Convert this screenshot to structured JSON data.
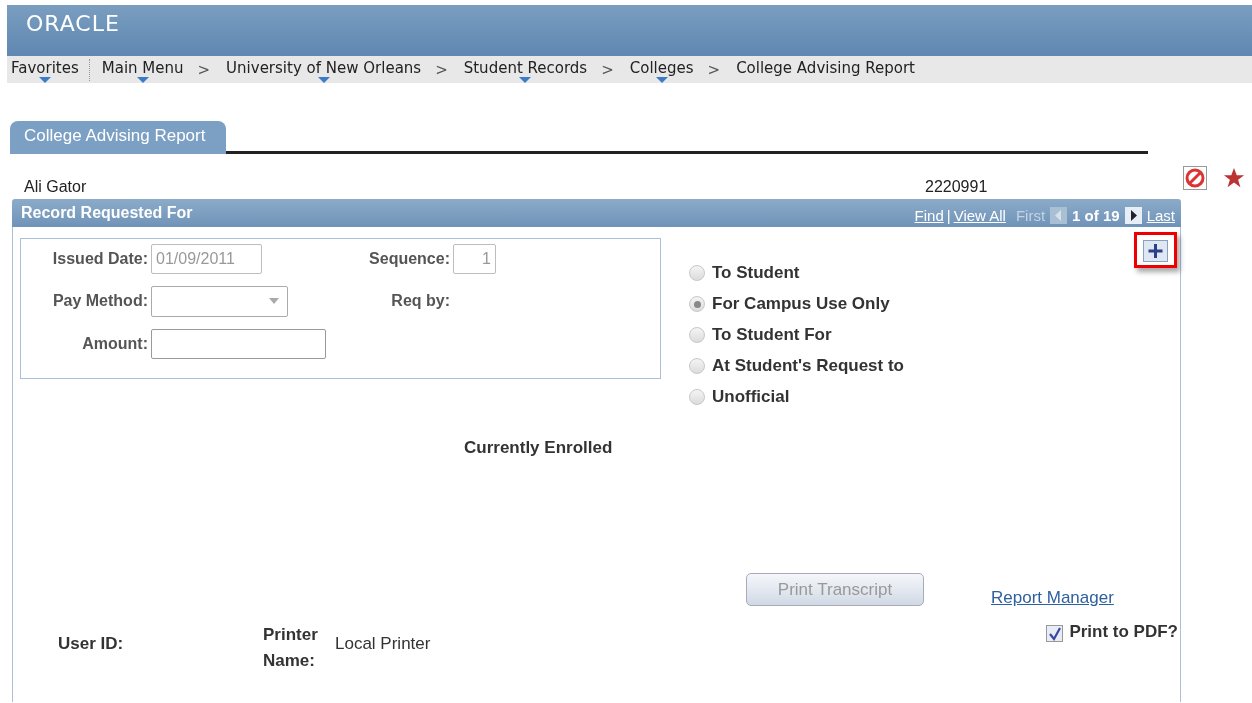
{
  "logo": "ORACLE",
  "breadcrumbs": [
    {
      "kind": "item",
      "label": "Favorites",
      "has_menu": true
    },
    {
      "kind": "divider"
    },
    {
      "kind": "item",
      "label": "Main Menu",
      "has_menu": true
    },
    {
      "kind": "separator",
      "label": ">"
    },
    {
      "kind": "item",
      "label": "University of New Orleans",
      "has_menu": true
    },
    {
      "kind": "separator",
      "label": ">"
    },
    {
      "kind": "item",
      "label": "Student Records",
      "has_menu": true
    },
    {
      "kind": "separator",
      "label": ">"
    },
    {
      "kind": "item",
      "label": "Colleges",
      "has_menu": true
    },
    {
      "kind": "separator",
      "label": ">"
    },
    {
      "kind": "item",
      "label": "College Advising Report",
      "has_menu": false
    }
  ],
  "tabs": [
    {
      "label": "College Advising Report",
      "selected": true
    }
  ],
  "student": {
    "name": "Ali Gator",
    "id": "2220991"
  },
  "panel": {
    "title": "Record Requested For",
    "nav": {
      "find": "Find",
      "divider": "|",
      "view_all": "View All",
      "first": "First",
      "first_disabled": true,
      "count": "1 of 19",
      "last": "Last",
      "last_disabled": false
    },
    "add_button": {
      "highlighted": true
    },
    "fields": [
      {
        "label": "Issued Date:",
        "kind": "input",
        "value": "01/09/2011",
        "disabled": true
      },
      {
        "label": "Sequence:",
        "kind": "input",
        "value": "1",
        "disabled": true
      },
      {
        "label": "Pay Method:",
        "kind": "select"
      },
      {
        "label": "Req by:",
        "kind": "label"
      },
      {
        "label": "Amount:",
        "kind": "input",
        "disabled": false
      }
    ],
    "options": [
      {
        "label": "To Student",
        "selected": false
      },
      {
        "label": "For Campus Use Only",
        "selected": true
      },
      {
        "label": "To Student For",
        "selected": false
      },
      {
        "label": "At Student's Request to",
        "selected": false
      },
      {
        "label": "Unofficial",
        "selected": false
      }
    ],
    "status": "Currently Enrolled",
    "print_button": {
      "label": "Print Transcript",
      "disabled": true
    },
    "report_link": "Report Manager",
    "user_id_label": "User ID:",
    "printer_label": "Printer Name:",
    "printer_value": "Local Printer",
    "print_pdf": {
      "label": "Print to PDF?",
      "checked": true
    }
  }
}
